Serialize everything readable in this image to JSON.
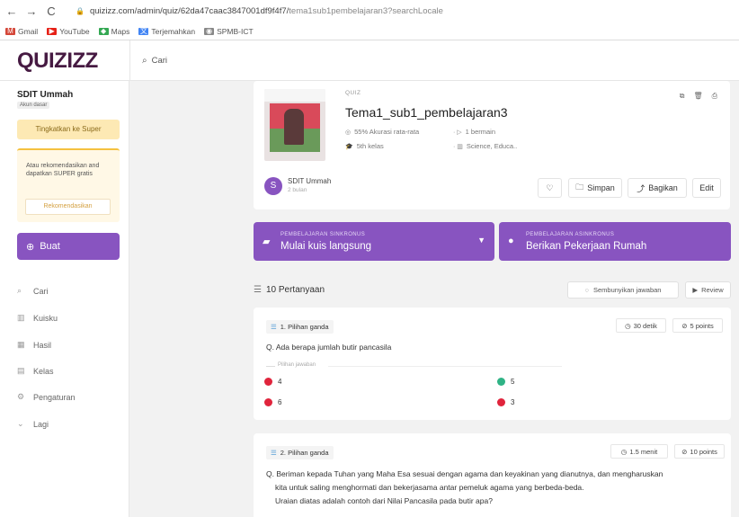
{
  "browser": {
    "back": "←",
    "forward": "→",
    "reload": "C",
    "url_main": "quizizz.com/admin/quiz/62da47caac3847001df9f4f7/",
    "url_rest": "tema1sub1pembelajaran3?searchLocale",
    "bookmarks": [
      {
        "label": "Gmail",
        "icon": "gmail-icon",
        "color": "#d44638"
      },
      {
        "label": "YouTube",
        "icon": "youtube-icon",
        "color": "#e62117"
      },
      {
        "label": "Maps",
        "icon": "maps-icon",
        "color": "#34a853"
      },
      {
        "label": "Terjemahkan",
        "icon": "translate-icon",
        "color": "#4285f4"
      },
      {
        "label": "SPMB-ICT",
        "icon": "globe-icon",
        "color": "#888888"
      }
    ]
  },
  "header": {
    "logo": "QUIZIZZ",
    "search_placeholder": "Cari"
  },
  "sidebar": {
    "user_name": "SDIT Ummah",
    "account_type": "Akun dasar",
    "upgrade_label": "Tingkatkan ke Super",
    "reco_text": "Atau rekomendasikan and dapatkan SUPER gratis",
    "reco_button": "Rekomendasikan",
    "create_label": "Buat",
    "menu": [
      {
        "label": "Cari",
        "icon": "search-icon",
        "glyph": "⌕"
      },
      {
        "label": "Kuisku",
        "icon": "library-icon",
        "glyph": "▥"
      },
      {
        "label": "Hasil",
        "icon": "reports-icon",
        "glyph": "▦"
      },
      {
        "label": "Kelas",
        "icon": "classes-icon",
        "glyph": "▤"
      },
      {
        "label": "Pengaturan",
        "icon": "settings-icon",
        "glyph": "⚙"
      },
      {
        "label": "Lagi",
        "icon": "chevron-down-icon",
        "glyph": "⌄"
      }
    ]
  },
  "quiz": {
    "label": "QUIZ",
    "title": "Tema1_sub1_pembelajaran3",
    "accuracy": "55% Akurasi rata-rata",
    "played": "1 bermain",
    "grade": "5th kelas",
    "subject": "Science, Educa..",
    "creator": "SDIT Ummah",
    "creator_time": "2 bulan",
    "avatar_letter": "S",
    "save_label": "Simpan",
    "share_label": "Bagikan",
    "edit_label": "Edit"
  },
  "play": {
    "sync_sub": "PEMBELAJARAN SINKRONUS",
    "sync_main": "Mulai kuis langsung",
    "async_sub": "PEMBELAJARAN ASINKRONUS",
    "async_main": "Berikan Pekerjaan Rumah"
  },
  "questions_header": {
    "count_label": "10 Pertanyaan",
    "hide_answers": "Sembunyikan jawaban",
    "review": "Review"
  },
  "questions": [
    {
      "type": "1. Pilihan ganda",
      "time": "30 detik",
      "points": "5 points",
      "text": "Ada berapa jumlah butir pancasila",
      "answer_label": "Pilihan jawaban",
      "answers": [
        {
          "text": "4",
          "color": "#e0243c"
        },
        {
          "text": "5",
          "color": "#2fb385"
        },
        {
          "text": "6",
          "color": "#e0243c"
        },
        {
          "text": "3",
          "color": "#e0243c"
        }
      ]
    },
    {
      "type": "2. Pilihan ganda",
      "time": "1.5 menit",
      "points": "10 points",
      "lines": [
        "Beriman kepada Tuhan yang Maha Esa sesuai dengan agama dan keyakinan yang dianutnya, dan mengharuskan",
        "kita untuk saling menghormati dan bekerjasama antar pemeluk agama yang berbeda-beda.",
        "Uraian diatas adalah contoh dari Nilai Pancasila pada butir apa?"
      ]
    }
  ],
  "colors": {
    "brand_purple": "#8854c0",
    "logo": "#461a42"
  }
}
